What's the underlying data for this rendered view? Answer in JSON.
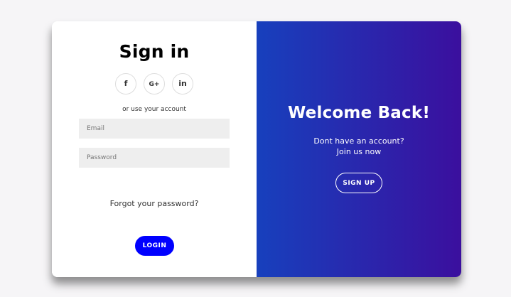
{
  "signin": {
    "title": "Sign in",
    "socials": [
      {
        "name": "facebook",
        "label": "f"
      },
      {
        "name": "google-plus",
        "label": "G+"
      },
      {
        "name": "linkedin",
        "label": "in"
      }
    ],
    "hint": "or use your account",
    "email_placeholder": "Email",
    "password_placeholder": "Password",
    "forgot_label": "Forgot your password?",
    "login_label": "LOGIN"
  },
  "overlay": {
    "title": "Welcome Back!",
    "text_line1": "Dont have an account?",
    "text_line2": "Join us now",
    "signup_label": "SIGN UP"
  },
  "colors": {
    "background": "#f6f5f7",
    "login_button": "#0000ff",
    "gradient_start": "#1740bd",
    "gradient_end": "#3b0f9e"
  }
}
